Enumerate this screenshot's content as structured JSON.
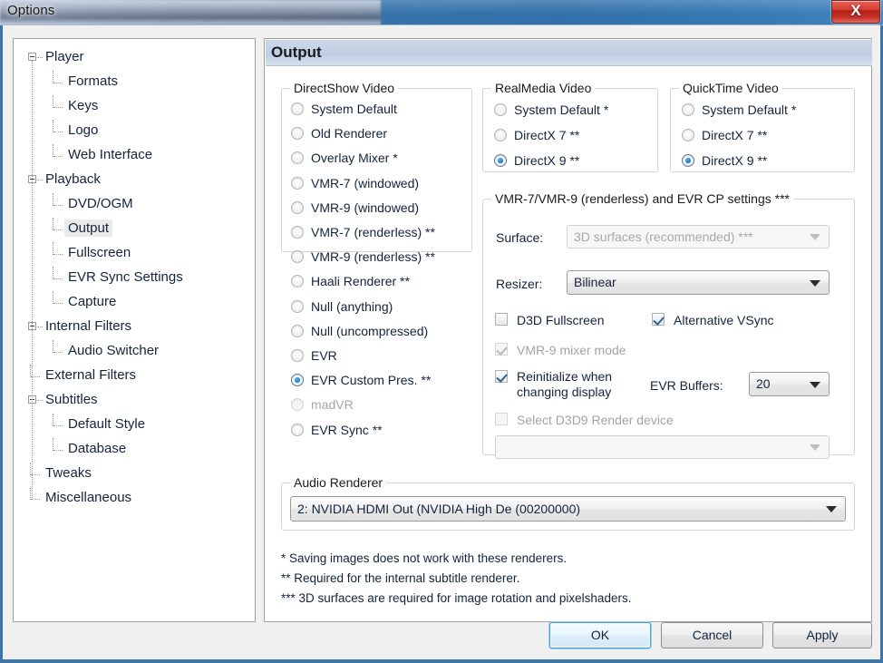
{
  "window": {
    "title": "Options",
    "close_label": "X"
  },
  "tree": {
    "nodes": [
      {
        "label": "Player",
        "level": 0,
        "expander": "minus"
      },
      {
        "label": "Formats",
        "level": 1,
        "expander": "none"
      },
      {
        "label": "Keys",
        "level": 1,
        "expander": "none"
      },
      {
        "label": "Logo",
        "level": 1,
        "expander": "none"
      },
      {
        "label": "Web Interface",
        "level": 1,
        "expander": "none"
      },
      {
        "label": "Playback",
        "level": 0,
        "expander": "minus"
      },
      {
        "label": "DVD/OGM",
        "level": 1,
        "expander": "none"
      },
      {
        "label": "Output",
        "level": 1,
        "expander": "none",
        "selected": true
      },
      {
        "label": "Fullscreen",
        "level": 1,
        "expander": "none"
      },
      {
        "label": "EVR Sync Settings",
        "level": 1,
        "expander": "none"
      },
      {
        "label": "Capture",
        "level": 1,
        "expander": "none"
      },
      {
        "label": "Internal Filters",
        "level": 0,
        "expander": "minus"
      },
      {
        "label": "Audio Switcher",
        "level": 1,
        "expander": "none"
      },
      {
        "label": "External Filters",
        "level": 0,
        "expander": "none"
      },
      {
        "label": "Subtitles",
        "level": 0,
        "expander": "minus"
      },
      {
        "label": "Default Style",
        "level": 1,
        "expander": "none"
      },
      {
        "label": "Database",
        "level": 1,
        "expander": "none"
      },
      {
        "label": "Tweaks",
        "level": 0,
        "expander": "none"
      },
      {
        "label": "Miscellaneous",
        "level": 0,
        "expander": "none"
      }
    ]
  },
  "page": {
    "title": "Output"
  },
  "directshow": {
    "group_title": "DirectShow Video",
    "options": [
      {
        "label": "System Default",
        "checked": false,
        "disabled": false
      },
      {
        "label": "Old Renderer",
        "checked": false,
        "disabled": false
      },
      {
        "label": "Overlay Mixer *",
        "checked": false,
        "disabled": false
      },
      {
        "label": "VMR-7 (windowed)",
        "checked": false,
        "disabled": false
      },
      {
        "label": "VMR-9 (windowed)",
        "checked": false,
        "disabled": false
      },
      {
        "label": "VMR-7 (renderless) **",
        "checked": false,
        "disabled": false
      },
      {
        "label": "VMR-9 (renderless) **",
        "checked": false,
        "disabled": false
      },
      {
        "label": "Haali Renderer **",
        "checked": false,
        "disabled": false
      },
      {
        "label": "Null (anything)",
        "checked": false,
        "disabled": false
      },
      {
        "label": "Null (uncompressed)",
        "checked": false,
        "disabled": false
      },
      {
        "label": "EVR",
        "checked": false,
        "disabled": false
      },
      {
        "label": "EVR Custom Pres. **",
        "checked": true,
        "disabled": false
      },
      {
        "label": "madVR",
        "checked": false,
        "disabled": true
      },
      {
        "label": "EVR Sync **",
        "checked": false,
        "disabled": false
      }
    ]
  },
  "realmedia": {
    "group_title": "RealMedia Video",
    "options": [
      {
        "label": "System Default *",
        "checked": false
      },
      {
        "label": "DirectX 7 **",
        "checked": false
      },
      {
        "label": "DirectX 9 **",
        "checked": true
      }
    ]
  },
  "quicktime": {
    "group_title": "QuickTime Video",
    "options": [
      {
        "label": "System Default *",
        "checked": false
      },
      {
        "label": "DirectX 7 **",
        "checked": false
      },
      {
        "label": "DirectX 9 **",
        "checked": true
      }
    ]
  },
  "renderless": {
    "group_title": "VMR-7/VMR-9 (renderless) and EVR CP settings ***",
    "surface_label": "Surface:",
    "surface_value": "3D surfaces (recommended) ***",
    "resizer_label": "Resizer:",
    "resizer_value": "Bilinear",
    "d3d_fullscreen": {
      "label": "D3D Fullscreen",
      "checked": false,
      "disabled": false
    },
    "alternative_vsync": {
      "label": "Alternative VSync",
      "checked": true,
      "disabled": false
    },
    "vmr9_mixer_mode": {
      "label": "VMR-9 mixer mode",
      "checked": true,
      "disabled": true
    },
    "reinitialize": {
      "label_line1": "Reinitialize when",
      "label_line2": "changing display",
      "checked": true,
      "disabled": false
    },
    "evr_buffers_label": "EVR Buffers:",
    "evr_buffers_value": "20",
    "select_d3d9": {
      "label": "Select D3D9 Render device",
      "checked": false,
      "disabled": true
    },
    "d3d9_device_value": ""
  },
  "audio_renderer": {
    "group_title": "Audio Renderer",
    "value": "2: NVIDIA HDMI Out (NVIDIA High De (00200000)"
  },
  "footnotes": [
    "* Saving images does not work with these renderers.",
    "** Required for the internal subtitle renderer.",
    "*** 3D surfaces are required for image rotation and pixelshaders."
  ],
  "buttons": {
    "ok": "OK",
    "cancel": "Cancel",
    "apply": "Apply"
  }
}
